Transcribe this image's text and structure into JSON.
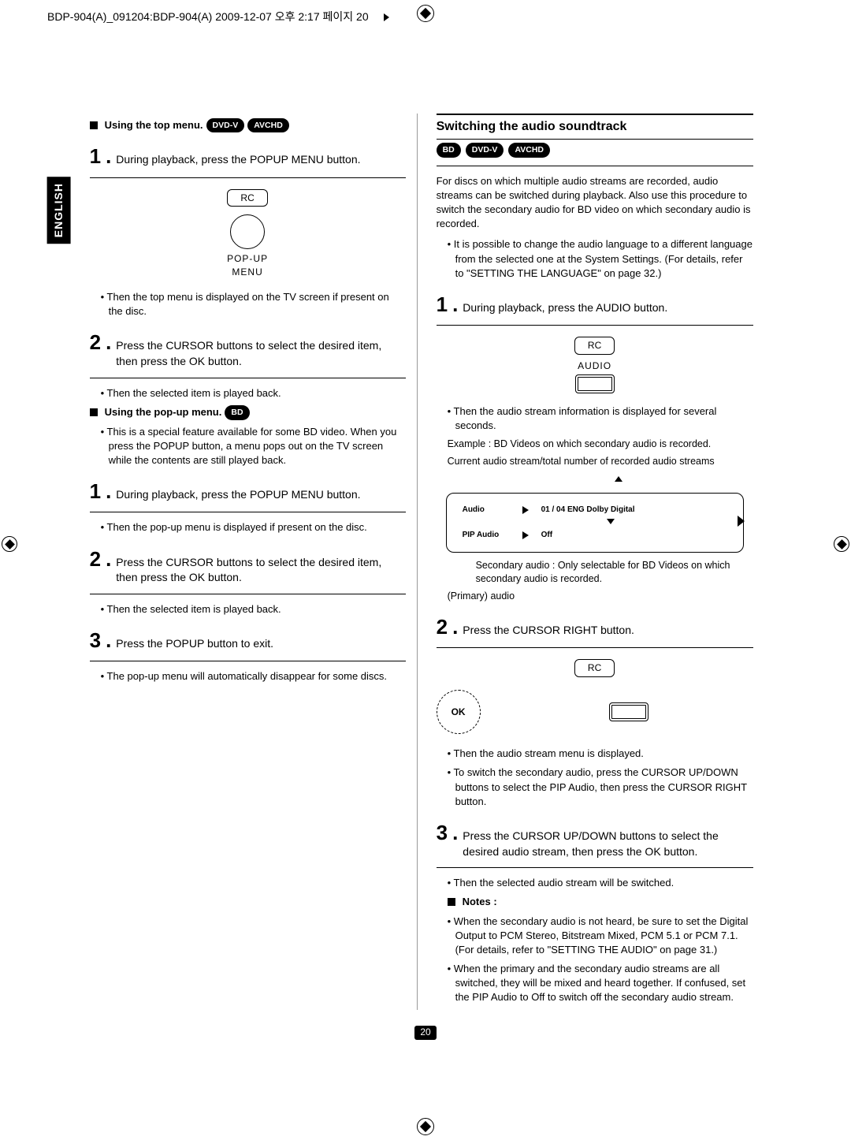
{
  "header": {
    "filename": "BDP-904(A)_091204:BDP-904(A)  2009-12-07  오후 2:17  페이지 20"
  },
  "sideTab": "ENGLISH",
  "pills": {
    "bd": "BD",
    "dvdv": "DVD-V",
    "avchd": "AVCHD"
  },
  "left": {
    "h1": "Using the top menu.",
    "s1": "During playback, press the POPUP MENU button.",
    "rc": {
      "label": "RC",
      "popup": "POP-UP",
      "menu": "MENU"
    },
    "s1b": "Then the top menu is displayed on the TV screen if present on the disc.",
    "s2": "Press the CURSOR buttons to select the desired item, then press the OK button.",
    "s2b": "Then the selected item is played back.",
    "h2": "Using the pop-up menu.",
    "h2note": "This is a special feature available for some BD video. When you press the POPUP button, a menu pops out on the TV screen while the contents are still played back.",
    "p1": "During playback, press the POPUP MENU button.",
    "p1b": "Then the pop-up menu is displayed if present on the disc.",
    "p2": "Press the CURSOR buttons to select the desired item, then press the OK button.",
    "p2b": "Then the selected item is played back.",
    "p3": "Press the POPUP button to exit.",
    "p3b": "The pop-up menu will automatically disappear for some discs."
  },
  "right": {
    "title": "Switching the audio soundtrack",
    "intro": "For discs on which multiple audio streams are recorded, audio streams can be switched during playback. Also use this procedure to switch the secondary audio for BD video on which secondary audio is recorded.",
    "introB": "It is possible to change the audio language to a different language from the selected one at the System Settings. (For details, refer to \"SETTING THE LANGUAGE\" on page 32.)",
    "s1": "During playback, press the AUDIO button.",
    "rcAudio": "AUDIO",
    "s1b": "Then the audio stream information is displayed for several seconds.",
    "example": "Example : BD Videos on which secondary audio is recorded.",
    "currentLine": "Current audio stream/total number of recorded audio streams",
    "panel": {
      "audioLbl": "Audio",
      "audioVal": "01 / 04 ENG Dolby Digital",
      "pipLbl": "PIP Audio",
      "pipVal": "Off"
    },
    "secNote": "Secondary audio : Only selectable for BD Videos on which secondary audio is recorded.",
    "primary": "(Primary) audio",
    "s2": "Press the CURSOR RIGHT button.",
    "rc2": "RC",
    "ok": "OK",
    "s2b1": "Then the audio stream menu is displayed.",
    "s2b2": "To switch the secondary audio, press the CURSOR UP/DOWN buttons to select the PIP Audio, then press the CURSOR RIGHT button.",
    "s3": "Press the CURSOR UP/DOWN buttons to select the desired audio stream, then press the OK button.",
    "s3b": "Then the selected audio stream will be switched.",
    "notesLbl": "Notes :",
    "note1": "When the secondary audio is not heard, be sure to set the Digital Output to PCM Stereo, Bitstream Mixed, PCM 5.1 or PCM 7.1. (For details, refer to \"SETTING THE AUDIO\" on page 31.)",
    "note2": "When the primary and the secondary audio streams are all switched, they will be mixed and heard together. If confused, set the PIP Audio to Off to switch off the secondary audio stream."
  },
  "pageNum": "20"
}
